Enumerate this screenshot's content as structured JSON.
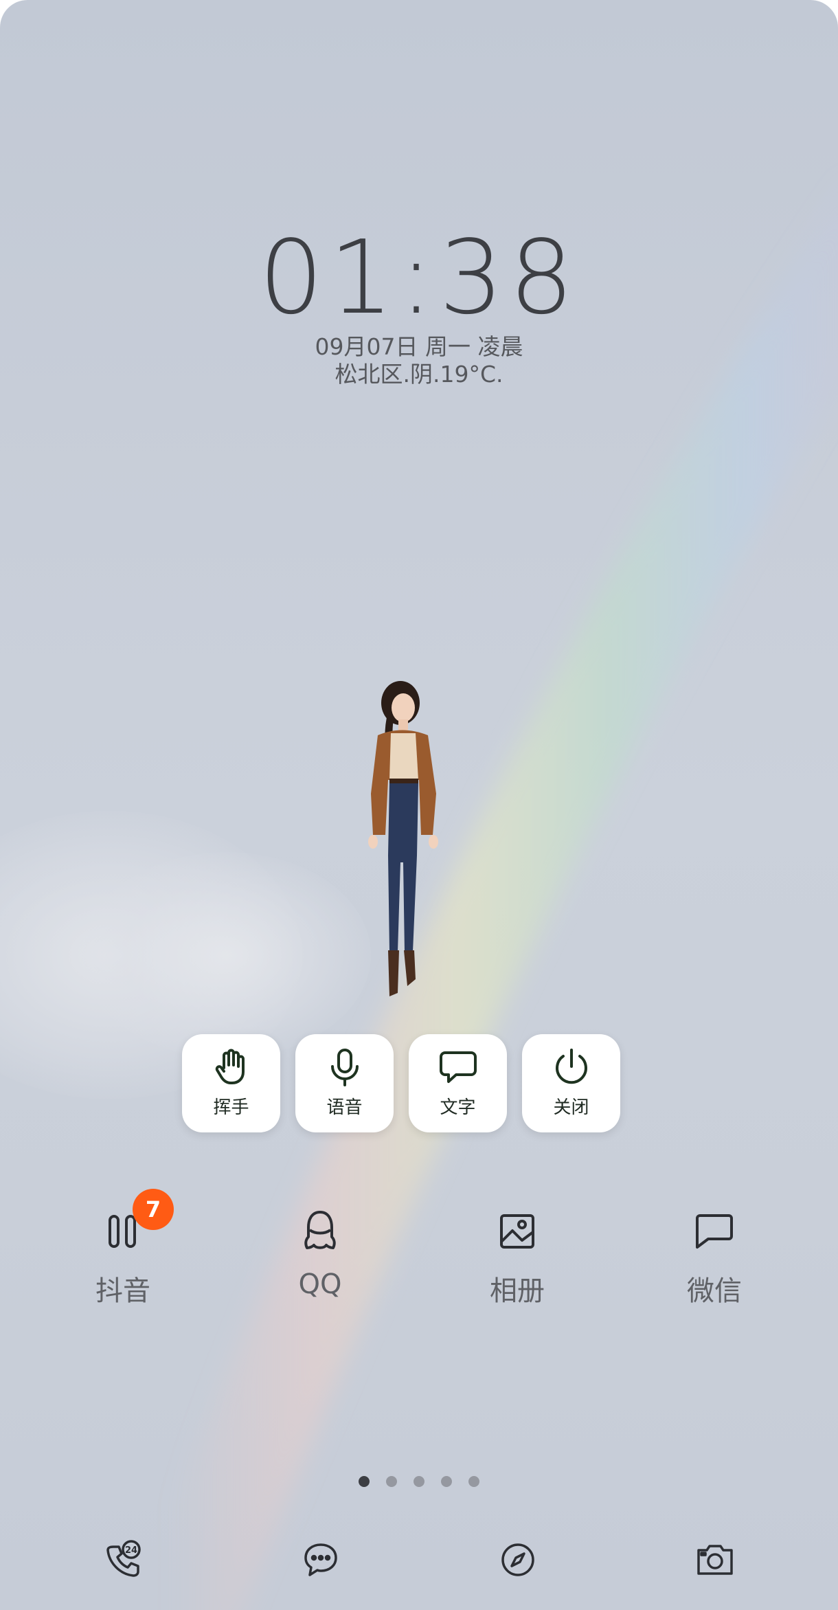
{
  "lockscreen": {
    "time": "01:38",
    "date": "09月07日 周一 凌晨",
    "weather": "松北区.阴.19°C."
  },
  "actions": [
    {
      "label": "挥手",
      "icon": "hand-wave-icon"
    },
    {
      "label": "语音",
      "icon": "microphone-icon"
    },
    {
      "label": "文字",
      "icon": "chat-bubble-icon"
    },
    {
      "label": "关闭",
      "icon": "power-icon"
    }
  ],
  "apps": [
    {
      "label": "抖音",
      "icon": "pause-icon",
      "badge": "7"
    },
    {
      "label": "QQ",
      "icon": "qq-penguin-icon"
    },
    {
      "label": "相册",
      "icon": "gallery-icon"
    },
    {
      "label": "微信",
      "icon": "message-icon"
    }
  ],
  "page_indicator": {
    "total": 5,
    "active": 1
  },
  "dock": [
    {
      "icon": "phone-24-icon"
    },
    {
      "icon": "messages-icon"
    },
    {
      "icon": "compass-icon"
    },
    {
      "icon": "camera-icon"
    }
  ],
  "colors": {
    "badge": "#ff5b14",
    "action_icon": "#1e3320",
    "label_gray": "#5f6166"
  }
}
